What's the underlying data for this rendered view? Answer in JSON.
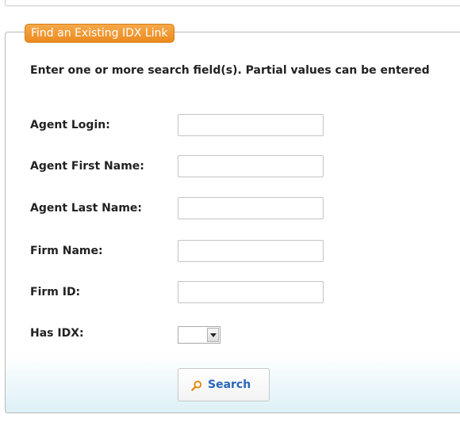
{
  "form": {
    "legend": "Find an Existing IDX Link",
    "instructions": "Enter one or more search field(s). Partial values can be entered",
    "fields": [
      {
        "label": "Agent Login:",
        "value": ""
      },
      {
        "label": "Agent First Name:",
        "value": ""
      },
      {
        "label": "Agent Last Name:",
        "value": ""
      },
      {
        "label": "Firm Name:",
        "value": ""
      },
      {
        "label": "Firm ID:",
        "value": ""
      }
    ],
    "has_idx": {
      "label": "Has IDX:",
      "selected": ""
    },
    "search_button": {
      "label": "Search",
      "icon": "search-icon",
      "label_color": "#2766b8"
    }
  },
  "colors": {
    "legend_bg": "#ec8a1e",
    "bottom_gradient": "#ddf1f7"
  }
}
